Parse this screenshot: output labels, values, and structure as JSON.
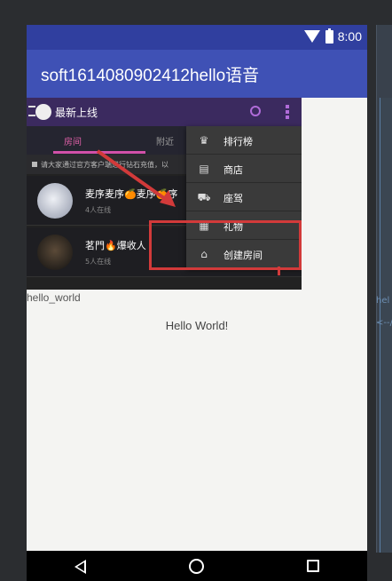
{
  "status": {
    "time": "8:00"
  },
  "app": {
    "title": "soft1614080902412hello语音"
  },
  "embedded": {
    "title": "最新上线",
    "tabs": [
      "房间",
      "附近"
    ],
    "notice": "请大家通过官方客户端进行钻石充值，以",
    "rooms": [
      {
        "name": "麦序麦序🍊麦序🍊序",
        "online": "4人在线"
      },
      {
        "name": "茗門🔥爆收人",
        "online": "5人在线"
      }
    ],
    "menu": [
      {
        "label": "排行榜",
        "icon": "crown-icon"
      },
      {
        "label": "商店",
        "icon": "store-icon"
      },
      {
        "label": "座驾",
        "icon": "car-icon"
      },
      {
        "label": "礼物",
        "icon": "gift-icon"
      },
      {
        "label": "创建房间",
        "icon": "add-home-icon"
      }
    ],
    "highlight_color": "#d23a3a"
  },
  "content": {
    "label": "hello_world",
    "message": "Hello World!"
  },
  "ide": {
    "side_label": "hel",
    "side_arrow": "<--/"
  },
  "colors": {
    "statusbar": "#303f9f",
    "appbar": "#3f51b5",
    "accent": "#d250a8"
  }
}
